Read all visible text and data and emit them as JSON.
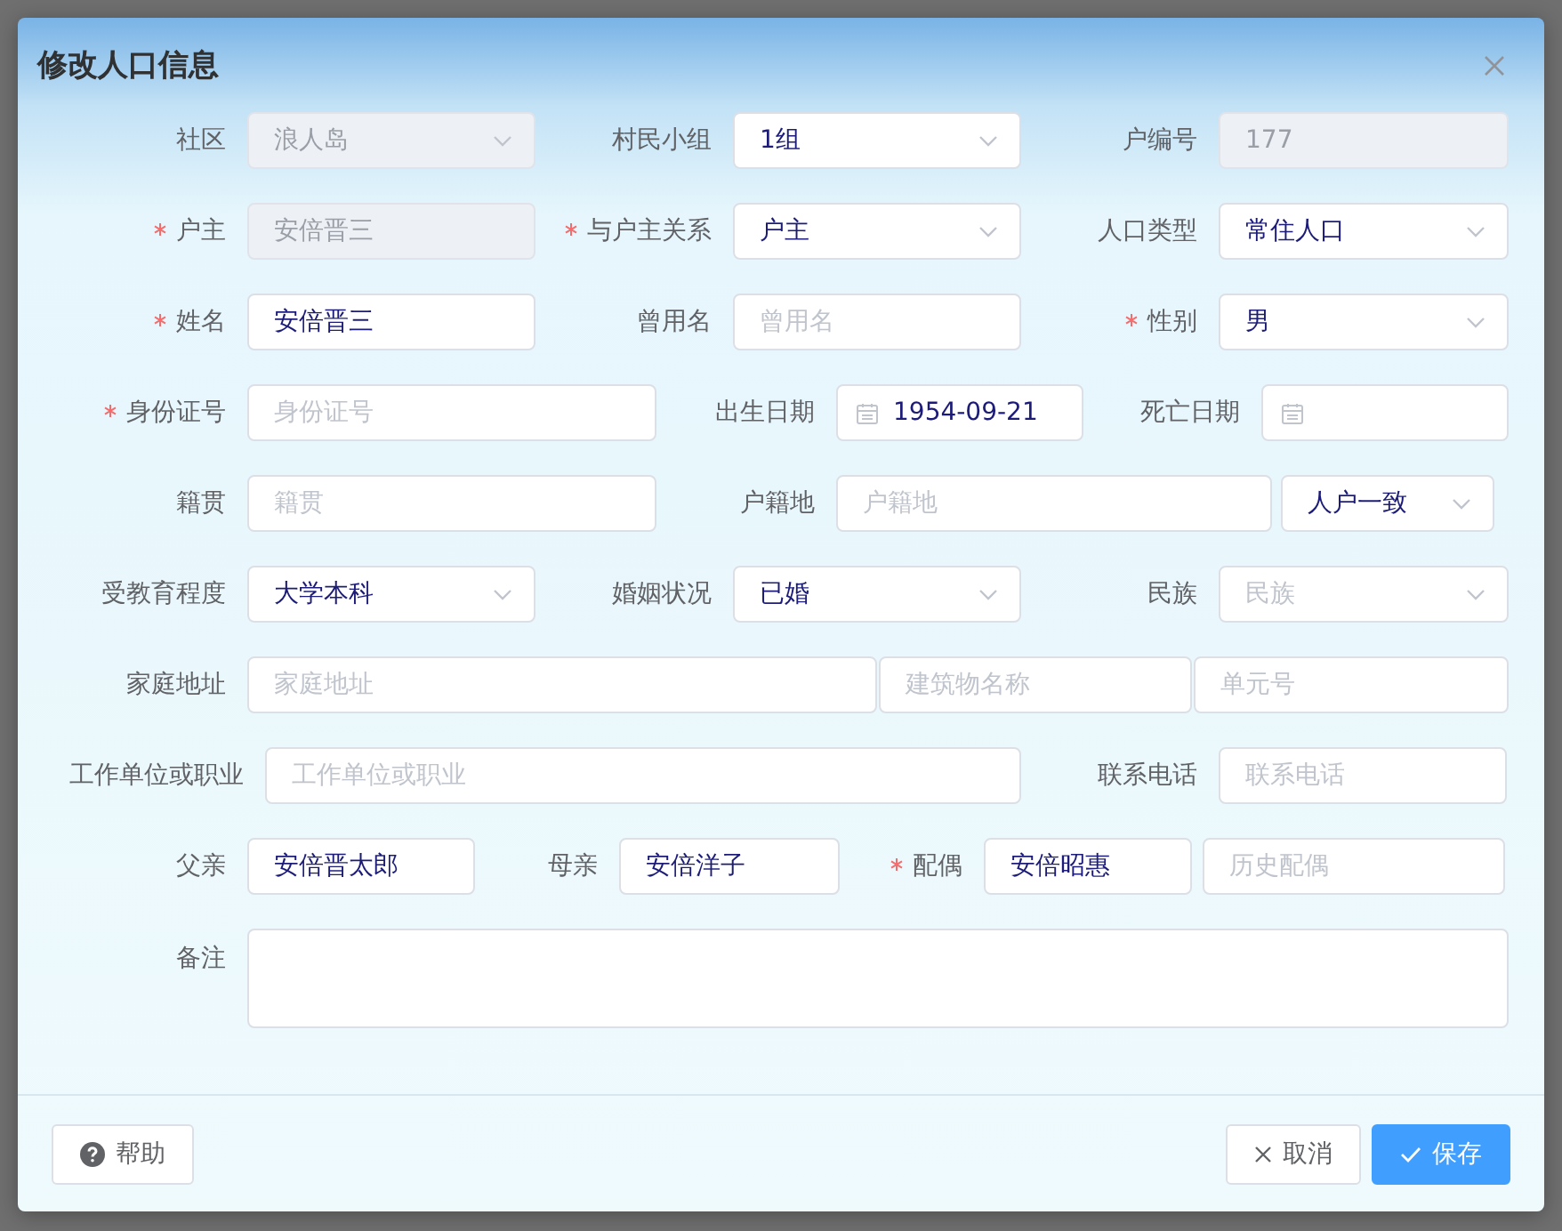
{
  "dialog": {
    "title": "修改人口信息"
  },
  "rows": [
    {
      "items": [
        {
          "label": "社区",
          "required": false,
          "fields": [
            {
              "kind": "select",
              "value": "浪人岛",
              "disabled": true
            }
          ]
        },
        {
          "label": "村民小组",
          "required": false,
          "fields": [
            {
              "kind": "select",
              "value": "1组",
              "disabled": false
            }
          ]
        },
        {
          "label": "户编号",
          "required": false,
          "fields": [
            {
              "kind": "input",
              "value": "177",
              "disabled": true
            }
          ]
        }
      ]
    },
    {
      "items": [
        {
          "label": "户主",
          "required": true,
          "fields": [
            {
              "kind": "input",
              "value": "安倍晋三",
              "disabled": true
            }
          ]
        },
        {
          "label": "与户主关系",
          "required": true,
          "fields": [
            {
              "kind": "select",
              "value": "户主",
              "disabled": false
            }
          ]
        },
        {
          "label": "人口类型",
          "required": false,
          "fields": [
            {
              "kind": "select",
              "value": "常住人口",
              "disabled": false
            }
          ]
        }
      ]
    },
    {
      "items": [
        {
          "label": "姓名",
          "required": true,
          "fields": [
            {
              "kind": "input",
              "value": "安倍晋三",
              "disabled": false
            }
          ]
        },
        {
          "label": "曾用名",
          "required": false,
          "fields": [
            {
              "kind": "input",
              "placeholder": "曾用名",
              "disabled": false
            }
          ]
        },
        {
          "label": "性别",
          "required": true,
          "fields": [
            {
              "kind": "select",
              "value": "男",
              "disabled": false
            }
          ]
        }
      ]
    },
    {
      "items": [
        {
          "label": "身份证号",
          "required": true,
          "fields": [
            {
              "kind": "input",
              "placeholder": "身份证号",
              "disabled": false
            }
          ]
        },
        {
          "label": "出生日期",
          "required": false,
          "fields": [
            {
              "kind": "date",
              "value": "1954-09-21",
              "disabled": false
            }
          ]
        },
        {
          "label": "死亡日期",
          "required": false,
          "fields": [
            {
              "kind": "date",
              "disabled": false
            }
          ]
        }
      ]
    },
    {
      "items": [
        {
          "label": "籍贯",
          "required": false,
          "fields": [
            {
              "kind": "input",
              "placeholder": "籍贯",
              "disabled": false
            }
          ]
        },
        {
          "label": "户籍地",
          "required": false,
          "fields": [
            {
              "kind": "input",
              "placeholder": "户籍地",
              "disabled": false
            },
            {
              "kind": "select",
              "value": "人户一致",
              "disabled": false
            }
          ]
        }
      ]
    },
    {
      "items": [
        {
          "label": "受教育程度",
          "required": false,
          "fields": [
            {
              "kind": "select",
              "value": "大学本科",
              "disabled": false
            }
          ]
        },
        {
          "label": "婚姻状况",
          "required": false,
          "fields": [
            {
              "kind": "select",
              "value": "已婚",
              "disabled": false
            }
          ]
        },
        {
          "label": "民族",
          "required": false,
          "fields": [
            {
              "kind": "select",
              "placeholder": "民族",
              "disabled": false
            }
          ]
        }
      ]
    },
    {
      "items": [
        {
          "label": "家庭地址",
          "required": false,
          "fields": [
            {
              "kind": "input",
              "placeholder": "家庭地址",
              "disabled": false
            },
            {
              "kind": "input",
              "placeholder": "建筑物名称",
              "disabled": false
            },
            {
              "kind": "input",
              "placeholder": "单元号",
              "disabled": false
            }
          ]
        }
      ]
    },
    {
      "items": [
        {
          "label": "工作单位或职业",
          "required": false,
          "fields": [
            {
              "kind": "input",
              "placeholder": "工作单位或职业",
              "disabled": false
            }
          ]
        },
        {
          "label": "联系电话",
          "required": false,
          "fields": [
            {
              "kind": "input",
              "placeholder": "联系电话",
              "disabled": false
            }
          ]
        }
      ]
    },
    {
      "items": [
        {
          "label": "父亲",
          "required": false,
          "fields": [
            {
              "kind": "input",
              "value": "安倍晋太郎",
              "disabled": false
            }
          ]
        },
        {
          "label": "母亲",
          "required": false,
          "fields": [
            {
              "kind": "input",
              "value": "安倍洋子",
              "disabled": false
            }
          ]
        },
        {
          "label": "配偶",
          "required": true,
          "fields": [
            {
              "kind": "input",
              "value": "安倍昭惠",
              "disabled": false
            },
            {
              "kind": "input",
              "placeholder": "历史配偶",
              "disabled": false
            }
          ]
        }
      ]
    },
    {
      "items": [
        {
          "label": "备注",
          "required": false,
          "fields": [
            {
              "kind": "textarea",
              "disabled": false
            }
          ]
        }
      ]
    }
  ],
  "footer": [
    {
      "label": "帮助",
      "kind": "help"
    },
    {
      "label": "取消",
      "kind": "cancel"
    },
    {
      "label": "保存",
      "kind": "primary"
    }
  ]
}
